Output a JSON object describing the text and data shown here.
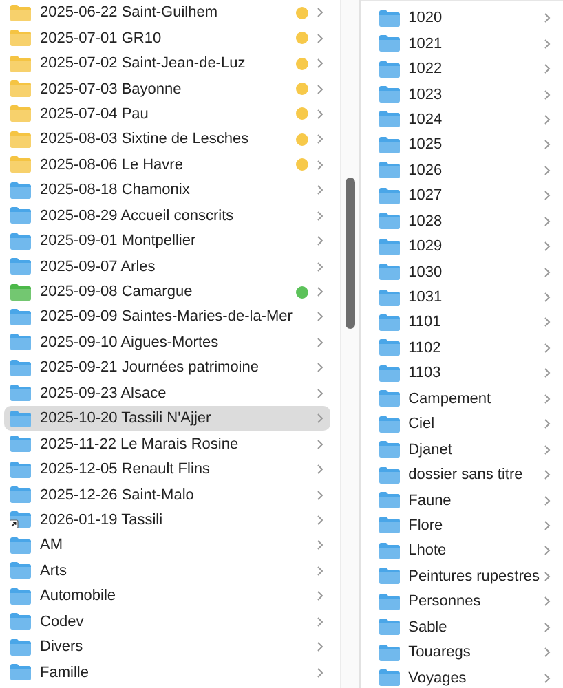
{
  "columns": [
    {
      "items": [
        {
          "name": "2025-06-22 Saint-Guilhem",
          "color": "#f5c443",
          "tag": {
            "color": "#f7c94a"
          },
          "alias": false,
          "selected": false
        },
        {
          "name": "2025-07-01 GR10",
          "color": "#f5c443",
          "tag": {
            "color": "#f7c94a"
          },
          "alias": false,
          "selected": false
        },
        {
          "name": "2025-07-02 Saint-Jean-de-Luz",
          "color": "#f5c443",
          "tag": {
            "color": "#f7c94a"
          },
          "alias": false,
          "selected": false
        },
        {
          "name": "2025-07-03 Bayonne",
          "color": "#f5c443",
          "tag": {
            "color": "#f7c94a"
          },
          "alias": false,
          "selected": false
        },
        {
          "name": "2025-07-04 Pau",
          "color": "#f5c443",
          "tag": {
            "color": "#f7c94a"
          },
          "alias": false,
          "selected": false
        },
        {
          "name": "2025-08-03 Sixtine de Lesches",
          "color": "#f5c443",
          "tag": {
            "color": "#f7c94a"
          },
          "alias": false,
          "selected": false
        },
        {
          "name": "2025-08-06 Le Havre",
          "color": "#f5c443",
          "tag": {
            "color": "#f7c94a"
          },
          "alias": false,
          "selected": false
        },
        {
          "name": "2025-08-18 Chamonix",
          "color": "#4aa6e8",
          "alias": false,
          "selected": false
        },
        {
          "name": "2025-08-29 Accueil conscrits",
          "color": "#4aa6e8",
          "alias": false,
          "selected": false
        },
        {
          "name": "2025-09-01 Montpellier",
          "color": "#4aa6e8",
          "alias": false,
          "selected": false
        },
        {
          "name": "2025-09-07 Arles",
          "color": "#4aa6e8",
          "alias": false,
          "selected": false
        },
        {
          "name": "2025-09-08 Camargue",
          "color": "#4cb84a",
          "tag": {
            "color": "#5cc25a"
          },
          "alias": false,
          "selected": false
        },
        {
          "name": "2025-09-09 Saintes-Maries-de-la-Mer",
          "color": "#4aa6e8",
          "alias": false,
          "selected": false
        },
        {
          "name": "2025-09-10 Aigues-Mortes",
          "color": "#4aa6e8",
          "alias": false,
          "selected": false
        },
        {
          "name": "2025-09-21 Journées patrimoine",
          "color": "#4aa6e8",
          "alias": false,
          "selected": false
        },
        {
          "name": "2025-09-23 Alsace",
          "color": "#4aa6e8",
          "alias": false,
          "selected": false
        },
        {
          "name": "2025-10-20 Tassili N'Ajjer",
          "color": "#4aa6e8",
          "alias": false,
          "selected": true
        },
        {
          "name": "2025-11-22 Le Marais Rosine",
          "color": "#4aa6e8",
          "alias": false,
          "selected": false
        },
        {
          "name": "2025-12-05 Renault Flins",
          "color": "#4aa6e8",
          "alias": false,
          "selected": false
        },
        {
          "name": "2025-12-26 Saint-Malo",
          "color": "#4aa6e8",
          "alias": false,
          "selected": false
        },
        {
          "name": "2026-01-19 Tassili",
          "color": "#4aa6e8",
          "alias": true,
          "selected": false
        },
        {
          "name": "AM",
          "color": "#4aa6e8",
          "alias": false,
          "selected": false
        },
        {
          "name": "Arts",
          "color": "#4aa6e8",
          "alias": false,
          "selected": false
        },
        {
          "name": "Automobile",
          "color": "#4aa6e8",
          "alias": false,
          "selected": false
        },
        {
          "name": "Codev",
          "color": "#4aa6e8",
          "alias": false,
          "selected": false
        },
        {
          "name": "Divers",
          "color": "#4aa6e8",
          "alias": false,
          "selected": false
        },
        {
          "name": "Famille",
          "color": "#4aa6e8",
          "alias": false,
          "selected": false
        }
      ]
    },
    {
      "items": [
        {
          "name": "1020",
          "color": "#4aa6e8",
          "alias": false,
          "selected": false
        },
        {
          "name": "1021",
          "color": "#4aa6e8",
          "alias": false,
          "selected": false
        },
        {
          "name": "1022",
          "color": "#4aa6e8",
          "alias": false,
          "selected": false
        },
        {
          "name": "1023",
          "color": "#4aa6e8",
          "alias": false,
          "selected": false
        },
        {
          "name": "1024",
          "color": "#4aa6e8",
          "alias": false,
          "selected": false
        },
        {
          "name": "1025",
          "color": "#4aa6e8",
          "alias": false,
          "selected": false
        },
        {
          "name": "1026",
          "color": "#4aa6e8",
          "alias": false,
          "selected": false
        },
        {
          "name": "1027",
          "color": "#4aa6e8",
          "alias": false,
          "selected": false
        },
        {
          "name": "1028",
          "color": "#4aa6e8",
          "alias": false,
          "selected": false
        },
        {
          "name": "1029",
          "color": "#4aa6e8",
          "alias": false,
          "selected": false
        },
        {
          "name": "1030",
          "color": "#4aa6e8",
          "alias": false,
          "selected": false
        },
        {
          "name": "1031",
          "color": "#4aa6e8",
          "alias": false,
          "selected": false
        },
        {
          "name": "1101",
          "color": "#4aa6e8",
          "alias": false,
          "selected": false
        },
        {
          "name": "1102",
          "color": "#4aa6e8",
          "alias": false,
          "selected": false
        },
        {
          "name": "1103",
          "color": "#4aa6e8",
          "alias": false,
          "selected": false
        },
        {
          "name": "Campement",
          "color": "#4aa6e8",
          "alias": false,
          "selected": false
        },
        {
          "name": "Ciel",
          "color": "#4aa6e8",
          "alias": false,
          "selected": false
        },
        {
          "name": "Djanet",
          "color": "#4aa6e8",
          "alias": false,
          "selected": false
        },
        {
          "name": "dossier sans titre",
          "color": "#4aa6e8",
          "alias": false,
          "selected": false
        },
        {
          "name": "Faune",
          "color": "#4aa6e8",
          "alias": false,
          "selected": false
        },
        {
          "name": "Flore",
          "color": "#4aa6e8",
          "alias": false,
          "selected": false
        },
        {
          "name": "Lhote",
          "color": "#4aa6e8",
          "alias": false,
          "selected": false
        },
        {
          "name": "Peintures rupestres",
          "color": "#4aa6e8",
          "alias": false,
          "selected": false
        },
        {
          "name": "Personnes",
          "color": "#4aa6e8",
          "alias": false,
          "selected": false
        },
        {
          "name": "Sable",
          "color": "#4aa6e8",
          "alias": false,
          "selected": false
        },
        {
          "name": "Touaregs",
          "color": "#4aa6e8",
          "alias": false,
          "selected": false
        },
        {
          "name": "Voyages",
          "color": "#4aa6e8",
          "alias": false,
          "selected": false
        }
      ]
    }
  ]
}
